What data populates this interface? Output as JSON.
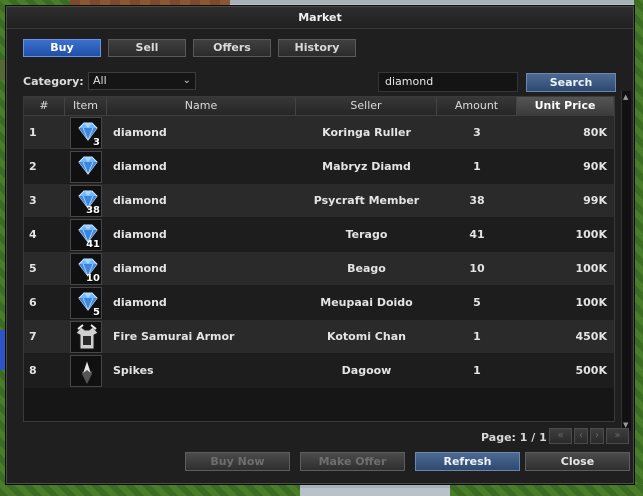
{
  "window": {
    "title": "Market"
  },
  "tabs": [
    {
      "label": "Buy",
      "active": true
    },
    {
      "label": "Sell",
      "active": false
    },
    {
      "label": "Offers",
      "active": false
    },
    {
      "label": "History",
      "active": false
    }
  ],
  "filters": {
    "category_label": "Category:",
    "category_value": "All",
    "search_value": "diamond",
    "search_button": "Search"
  },
  "table": {
    "headers": [
      "#",
      "Item",
      "Name",
      "Seller",
      "Amount",
      "Unit Price"
    ],
    "sorted_column": "Unit Price",
    "rows": [
      {
        "num": "1",
        "count": "3",
        "icon": "diamond-icon",
        "name": "diamond",
        "seller": "Koringa Ruller",
        "amount": "3",
        "price": "80K"
      },
      {
        "num": "2",
        "count": "",
        "icon": "diamond-icon",
        "name": "diamond",
        "seller": "Mabryz Diamd",
        "amount": "1",
        "price": "90K"
      },
      {
        "num": "3",
        "count": "38",
        "icon": "diamond-icon",
        "name": "diamond",
        "seller": "Psycraft Member",
        "amount": "38",
        "price": "99K"
      },
      {
        "num": "4",
        "count": "41",
        "icon": "diamond-icon",
        "name": "diamond",
        "seller": "Terago",
        "amount": "41",
        "price": "100K"
      },
      {
        "num": "5",
        "count": "10",
        "icon": "diamond-icon",
        "name": "diamond",
        "seller": "Beago",
        "amount": "10",
        "price": "100K"
      },
      {
        "num": "6",
        "count": "5",
        "icon": "diamond-icon",
        "name": "diamond",
        "seller": "Meupaai Doido",
        "amount": "5",
        "price": "100K"
      },
      {
        "num": "7",
        "count": "",
        "icon": "armor-icon",
        "name": "Fire Samurai Armor",
        "seller": "Kotomi Chan",
        "amount": "1",
        "price": "450K"
      },
      {
        "num": "8",
        "count": "",
        "icon": "spikes-icon",
        "name": "Spikes",
        "seller": "Dagoow",
        "amount": "1",
        "price": "500K"
      }
    ]
  },
  "pagination": {
    "label": "Page: 1 / 1"
  },
  "actions": {
    "buy_now": "Buy Now",
    "make_offer": "Make Offer",
    "refresh": "Refresh",
    "close": "Close"
  },
  "colors": {
    "accent_tab": "#2f5fbf",
    "window_bg": "#1f1f1f",
    "row_alt": "#2a2a2a"
  }
}
